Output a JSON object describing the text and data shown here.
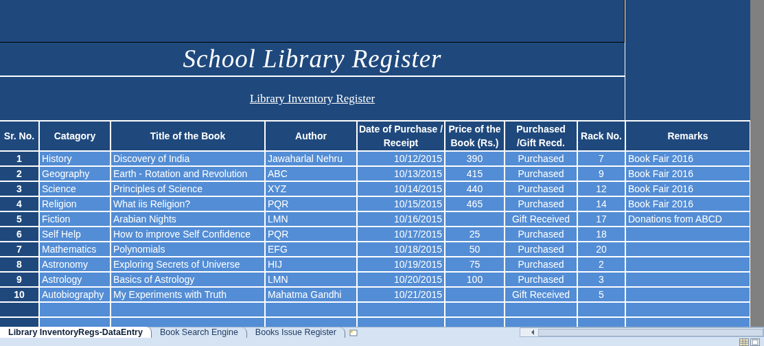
{
  "title": "School Library Register",
  "subtitle": "Library Inventory Register",
  "columns": [
    "Sr. No.",
    "Catagory",
    "Title of the Book",
    "Author",
    "Date of Purchase / Receipt",
    "Price of the Book (Rs.)",
    "Purchased /Gift Recd.",
    "Rack No.",
    "Remarks"
  ],
  "rows": [
    {
      "sr": "1",
      "category": "History",
      "title": "Discovery of India",
      "author": "Jawaharlal Nehru",
      "date": "10/12/2015",
      "price": "390",
      "source": "Purchased",
      "rack": "7",
      "remarks": "Book Fair 2016"
    },
    {
      "sr": "2",
      "category": "Geography",
      "title": "Earth - Rotation and Revolution",
      "author": "ABC",
      "date": "10/13/2015",
      "price": "415",
      "source": "Purchased",
      "rack": "9",
      "remarks": "Book Fair 2016"
    },
    {
      "sr": "3",
      "category": "Science",
      "title": "Principles of Science",
      "author": "XYZ",
      "date": "10/14/2015",
      "price": "440",
      "source": "Purchased",
      "rack": "12",
      "remarks": "Book Fair 2016"
    },
    {
      "sr": "4",
      "category": "Religion",
      "title": "What iis Religion?",
      "author": "PQR",
      "date": "10/15/2015",
      "price": "465",
      "source": "Purchased",
      "rack": "14",
      "remarks": "Book Fair 2016"
    },
    {
      "sr": "5",
      "category": "Fiction",
      "title": "Arabian Nights",
      "author": "LMN",
      "date": "10/16/2015",
      "source": "Gift Received",
      "rack": "17",
      "remarks": "Donations from ABCD"
    },
    {
      "sr": "6",
      "category": "Self Help",
      "title": "How to improve Self Confidence",
      "author": "PQR",
      "date": "10/17/2015",
      "price": "25",
      "source": "Purchased",
      "rack": "18"
    },
    {
      "sr": "7",
      "category": "Mathematics",
      "title": "Polynomials",
      "author": "EFG",
      "date": "10/18/2015",
      "price": "50",
      "source": "Purchased",
      "rack": "20"
    },
    {
      "sr": "8",
      "category": "Astronomy",
      "title": "Exploring Secrets of Universe",
      "author": "HIJ",
      "date": "10/19/2015",
      "price": "75",
      "source": "Purchased",
      "rack": "2"
    },
    {
      "sr": "9",
      "category": "Astrology",
      "title": "Basics of Astrology",
      "author": "LMN",
      "date": "10/20/2015",
      "price": "100",
      "source": "Purchased",
      "rack": "3"
    },
    {
      "sr": "10",
      "category": "Autobiography",
      "title": "My Experiments with Truth",
      "author": "Mahatma Gandhi",
      "date": "10/21/2015",
      "source": "Gift Received",
      "rack": "5"
    }
  ],
  "sheet_tabs": [
    {
      "label": "Library InventoryRegs-DataEntry",
      "selected": true
    },
    {
      "label": "Book Search Engine",
      "selected": false
    },
    {
      "label": "Books Issue Register",
      "selected": false
    }
  ]
}
